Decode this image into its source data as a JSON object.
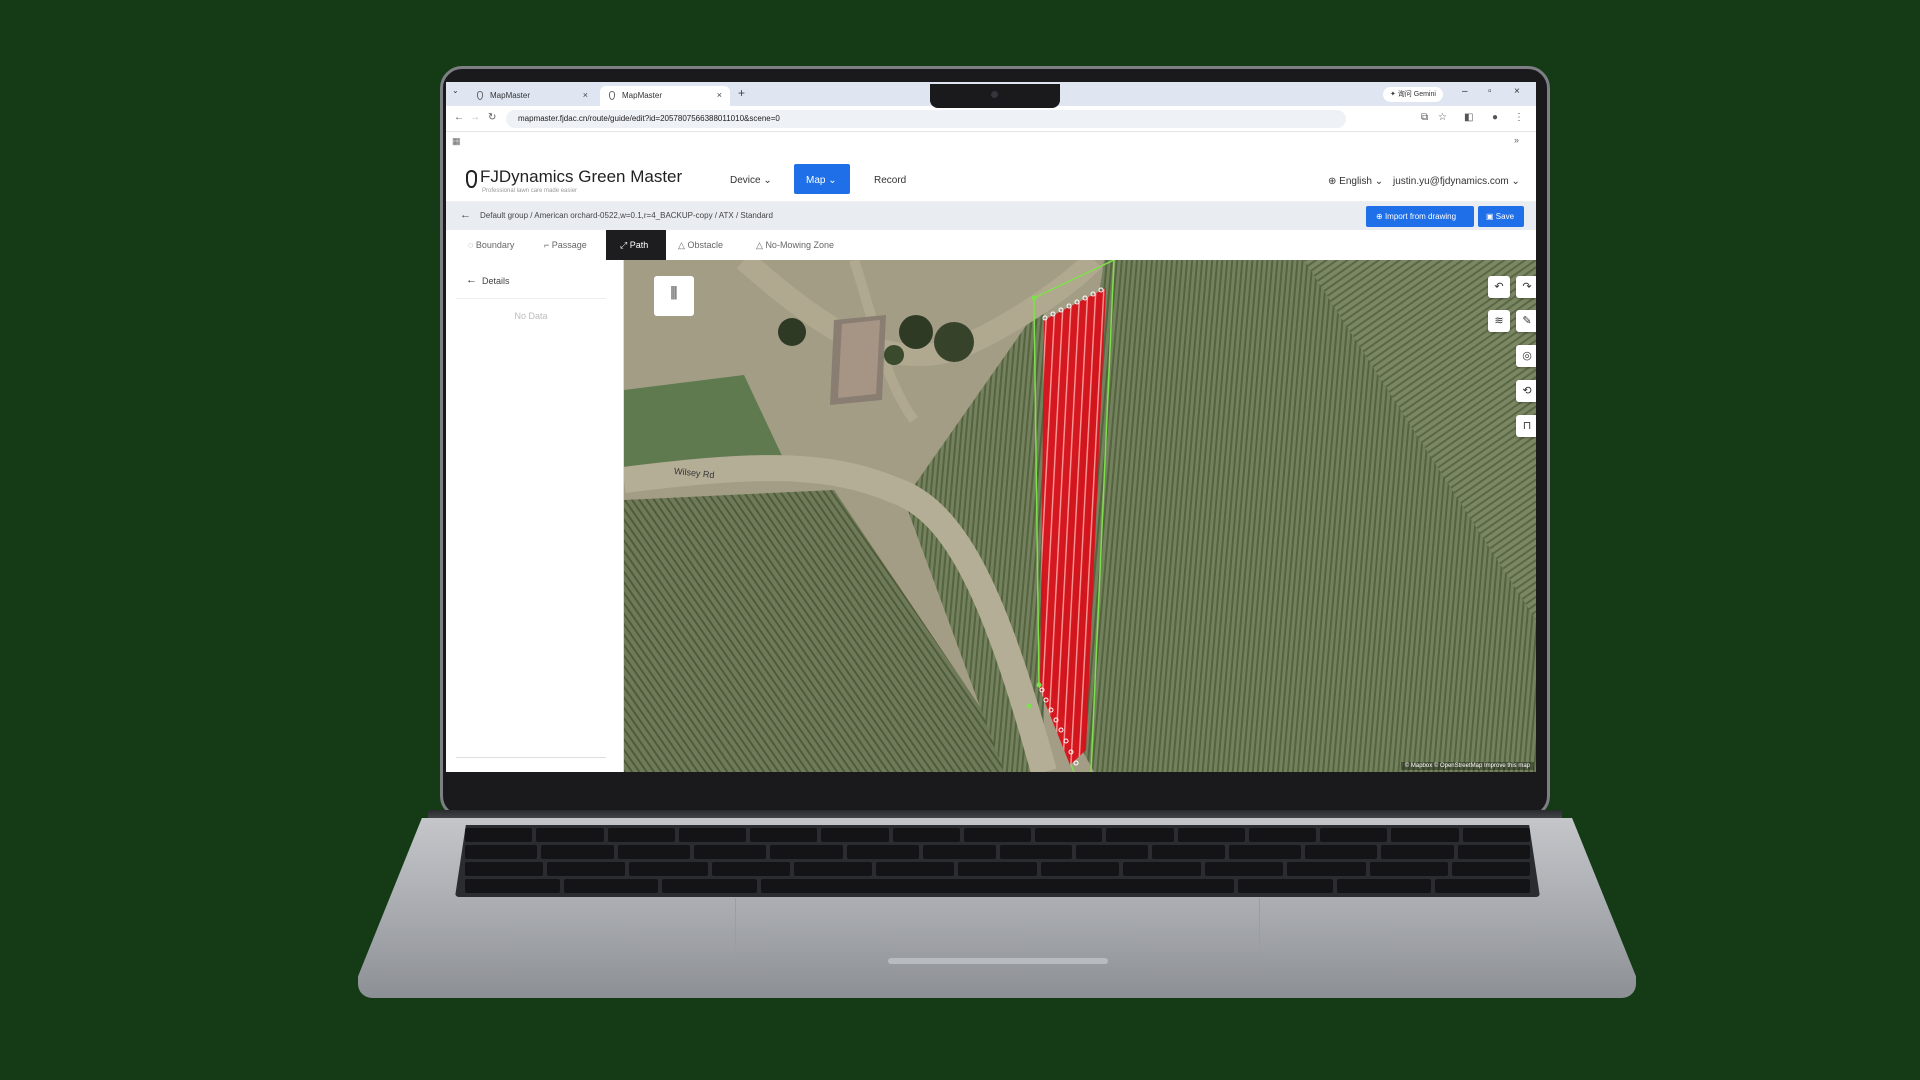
{
  "browser": {
    "tabs": [
      {
        "title": "MapMaster",
        "active": false
      },
      {
        "title": "MapMaster",
        "active": true
      }
    ],
    "new_tab": "+",
    "gemini_label": "✦ 询问 Gemini",
    "url": "mapmaster.fjdac.cn/route/guide/edit?id=2057807566388011010&scene=0",
    "more": "»"
  },
  "app": {
    "brand": "FJDynamics Green Master",
    "tagline": "Professional lawn care made easier",
    "nav": {
      "device": "Device",
      "map": "Map",
      "record": "Record"
    },
    "language": "English",
    "user": "justin.yu@fjdynamics.com",
    "accent_color": "#1f6fe8"
  },
  "breadcrumb": {
    "path": "Default group / American orchard-0522,w=0.1,r=4_BACKUP-copy / ATX / Standard",
    "import_button": "Import from drawing",
    "save_button": "Save"
  },
  "modes": [
    {
      "label": "Boundary",
      "active": false
    },
    {
      "label": "Passage",
      "active": false
    },
    {
      "label": "Path",
      "active": true
    },
    {
      "label": "Obstacle",
      "active": false
    },
    {
      "label": "No-Mowing Zone",
      "active": false
    }
  ],
  "panel": {
    "title": "Details",
    "empty_text": "No Data"
  },
  "map": {
    "road_label": "Wilsey Rd",
    "attribution": "© Mapbox © OpenStreetMap Improve this map",
    "path_color": "#e0121a",
    "boundary_color": "#7ee04b",
    "tools": [
      "undo-icon",
      "redo-icon",
      "layers-icon",
      "pencil-icon",
      "locate-icon",
      "rotate-icon",
      "lock-icon"
    ]
  }
}
